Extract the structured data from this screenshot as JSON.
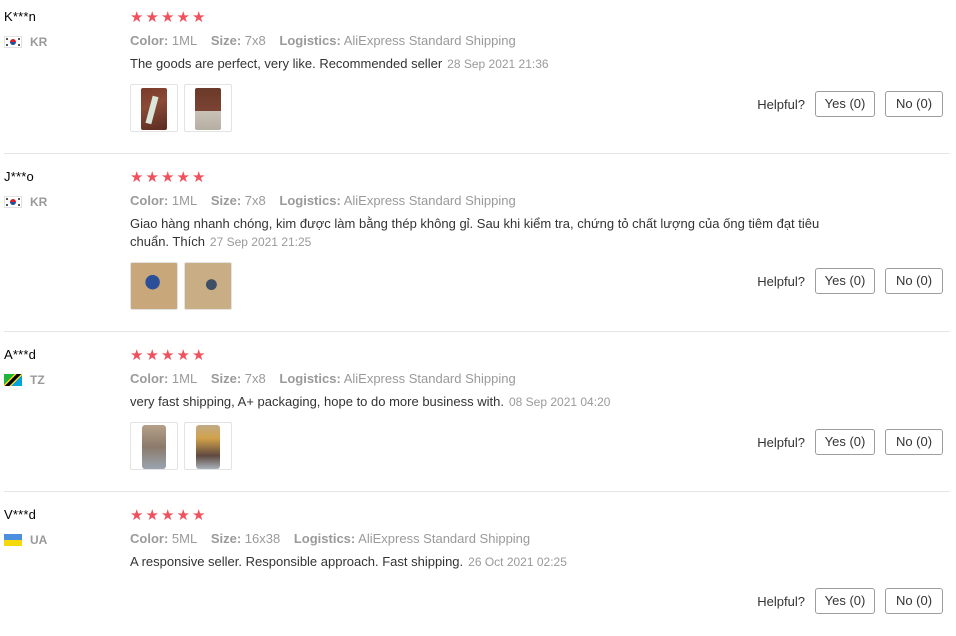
{
  "reviews": [
    {
      "user": "K***n",
      "country": "KR",
      "flag": "south-korea-flag-icon",
      "rating": 5,
      "color_label": "Color:",
      "color_value": "1ML",
      "size_label": "Size:",
      "size_value": "7x8",
      "logistics_label": "Logistics:",
      "logistics_value": "AliExpress Standard Shipping",
      "content": "The goods are perfect, very like. Recommended seller",
      "date": "28 Sep 2021 21:36",
      "photos": [
        "review-photo-1",
        "review-photo-2"
      ],
      "helpful_label": "Helpful?",
      "yes_label": "Yes (0)",
      "no_label": "No (0)"
    },
    {
      "user": "J***o",
      "country": "KR",
      "flag": "south-korea-flag-icon",
      "rating": 5,
      "color_label": "Color:",
      "color_value": "1ML",
      "size_label": "Size:",
      "size_value": "7x8",
      "logistics_label": "Logistics:",
      "logistics_value": "AliExpress Standard Shipping",
      "content": "Giao hàng nhanh chóng, kim được làm bằng thép không gỉ. Sau khi kiểm tra, chứng tỏ chất lượng của ống tiêm đạt tiêu chuẩn. Thích",
      "date": "27 Sep 2021 21:25",
      "photos": [
        "review-photo-1",
        "review-photo-2"
      ],
      "helpful_label": "Helpful?",
      "yes_label": "Yes (0)",
      "no_label": "No (0)"
    },
    {
      "user": "A***d",
      "country": "TZ",
      "flag": "tanzania-flag-icon",
      "rating": 5,
      "color_label": "Color:",
      "color_value": "1ML",
      "size_label": "Size:",
      "size_value": "7x8",
      "logistics_label": "Logistics:",
      "logistics_value": "AliExpress Standard Shipping",
      "content": "very fast shipping, A+ packaging, hope to do more business with.",
      "date": "08 Sep 2021 04:20",
      "photos": [
        "review-photo-1",
        "review-photo-2"
      ],
      "helpful_label": "Helpful?",
      "yes_label": "Yes (0)",
      "no_label": "No (0)"
    },
    {
      "user": "V***d",
      "country": "UA",
      "flag": "ukraine-flag-icon",
      "rating": 5,
      "color_label": "Color:",
      "color_value": "5ML",
      "size_label": "Size:",
      "size_value": "16x38",
      "logistics_label": "Logistics:",
      "logistics_value": "AliExpress Standard Shipping",
      "content": "A responsive seller. Responsible approach. Fast shipping.",
      "date": "26 Oct 2021 02:25",
      "photos": [],
      "helpful_label": "Helpful?",
      "yes_label": "Yes (0)",
      "no_label": "No (0)"
    }
  ],
  "colors": {
    "star": "#f0515f",
    "muted_text": "#9a9a9a",
    "body_text": "#333333",
    "divider": "#e6e6e6",
    "button_border": "#9d9d9d"
  },
  "icons": {
    "star": "star-icon"
  }
}
